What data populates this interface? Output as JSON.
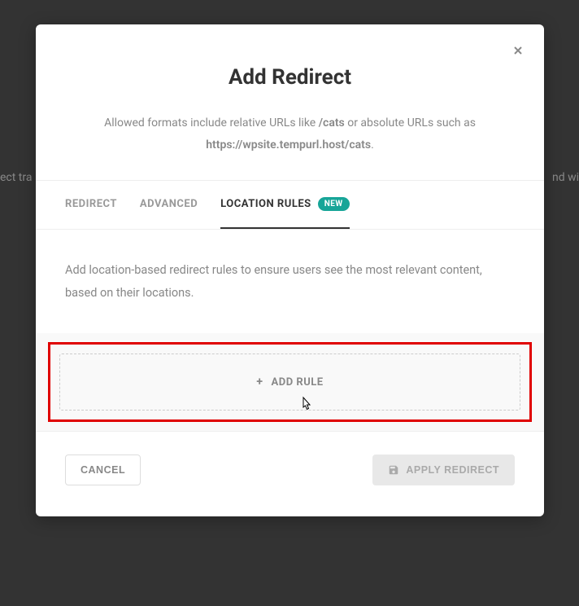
{
  "bg": {
    "left_text": "ect tra",
    "right_text": "nd wi"
  },
  "modal": {
    "title": "Add Redirect",
    "subtitle_prefix": "Allowed formats include relative URLs like ",
    "subtitle_bold1": "/cats",
    "subtitle_mid": " or absolute URLs such as ",
    "subtitle_bold2": "https://wpsite.tempurl.host/cats",
    "subtitle_suffix": "."
  },
  "tabs": {
    "redirect": "REDIRECT",
    "advanced": "ADVANCED",
    "location_rules": "LOCATION RULES",
    "badge": "NEW"
  },
  "content": {
    "description": "Add location-based redirect rules to ensure users see the most relevant content, based on their locations.",
    "add_rule_label": "ADD RULE"
  },
  "footer": {
    "cancel": "CANCEL",
    "apply": "APPLY REDIRECT"
  }
}
